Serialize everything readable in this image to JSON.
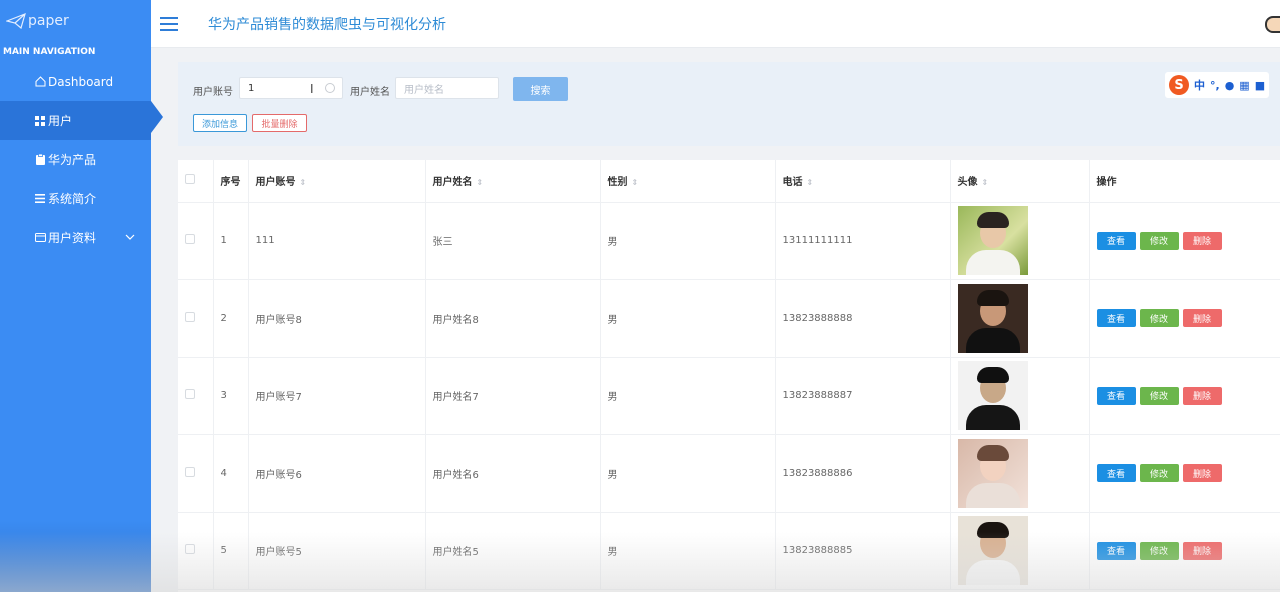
{
  "sidebar": {
    "logo_text": "paper",
    "nav_title": "MAIN NAVIGATION",
    "items": [
      {
        "label": "Dashboard",
        "icon": "home-icon"
      },
      {
        "label": "用户",
        "icon": "grid-icon"
      },
      {
        "label": "华为产品",
        "icon": "clipboard-icon"
      },
      {
        "label": "系统简介",
        "icon": "list-icon"
      },
      {
        "label": "用户资料",
        "icon": "folder-icon"
      }
    ],
    "active_index": 1
  },
  "header": {
    "title": "华为产品销售的数据爬虫与可视化分析"
  },
  "search": {
    "account_label": "用户账号",
    "account_value": "1",
    "name_label": "用户姓名",
    "name_placeholder": "用户姓名",
    "search_button": "搜索",
    "add_button": "添加信息",
    "batch_delete_button": "批量删除",
    "ime_label": "中"
  },
  "table": {
    "columns": [
      "序号",
      "用户账号",
      "用户姓名",
      "性别",
      "电话",
      "头像",
      "操作"
    ],
    "actions": {
      "view": "查看",
      "edit": "修改",
      "delete": "删除"
    },
    "rows": [
      {
        "index": "1",
        "account": "111",
        "name": "张三",
        "gender": "男",
        "phone": "13111111111"
      },
      {
        "index": "2",
        "account": "用户账号8",
        "name": "用户姓名8",
        "gender": "男",
        "phone": "13823888888"
      },
      {
        "index": "3",
        "account": "用户账号7",
        "name": "用户姓名7",
        "gender": "男",
        "phone": "13823888887"
      },
      {
        "index": "4",
        "account": "用户账号6",
        "name": "用户姓名6",
        "gender": "男",
        "phone": "13823888886"
      },
      {
        "index": "5",
        "account": "用户账号5",
        "name": "用户姓名5",
        "gender": "男",
        "phone": "13823888885"
      }
    ]
  },
  "colors": {
    "sidebar": "#3b8cf3",
    "accent": "#2e8bd6",
    "view": "#1b8fe3",
    "edit": "#6cb64c",
    "delete": "#ee6a6a"
  }
}
